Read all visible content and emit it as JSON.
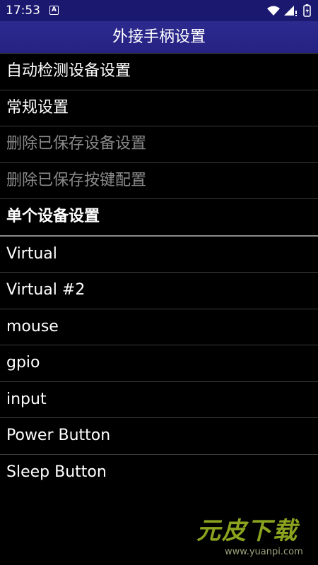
{
  "status_bar": {
    "time": "17:53",
    "notification_icon": "A",
    "icons": [
      "wifi-icon",
      "signal-icon",
      "battery-icon"
    ]
  },
  "title_bar": {
    "title": "外接手柄设置"
  },
  "menu": {
    "items": [
      {
        "label": "自动检测设备设置",
        "enabled": true
      },
      {
        "label": "常规设置",
        "enabled": true
      },
      {
        "label": "删除已保存设备设置",
        "enabled": false
      },
      {
        "label": "删除已保存按键配置",
        "enabled": false
      }
    ]
  },
  "section": {
    "header": "单个设备设置"
  },
  "devices": {
    "items": [
      {
        "label": "Virtual"
      },
      {
        "label": "Virtual #2"
      },
      {
        "label": "mouse"
      },
      {
        "label": "gpio"
      },
      {
        "label": "input"
      },
      {
        "label": "Power Button"
      },
      {
        "label": "Sleep Button"
      }
    ]
  },
  "watermark": {
    "text": "元皮下载",
    "url": "www.yuanpi.com"
  },
  "colors": {
    "status_bar": "#1b1870",
    "title_bar": "#2a2789",
    "background": "#000000",
    "divider": "#3c3c3c",
    "disabled_text": "#8a8a8a",
    "watermark": "#8aa41f"
  }
}
